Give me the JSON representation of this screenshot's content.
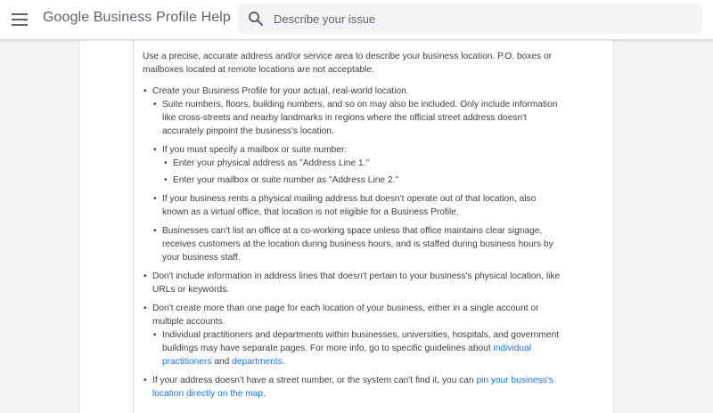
{
  "header": {
    "title": "Google Business Profile Help",
    "menu_icon": "hamburger-menu-icon",
    "search": {
      "placeholder": "Describe your issue",
      "value": "",
      "icon": "search-icon"
    }
  },
  "content": {
    "intro": "Use a precise, accurate address and/or service area to describe your business location. P.O. boxes or mailboxes located at remote locations are not acceptable.",
    "bullets": [
      {
        "text": "Create your Business Profile for your actual, real-world location.",
        "sub": [
          "Suite numbers, floors, building numbers, and so on may also be included. Only include information like cross-streets and nearby landmarks in regions where the official street address doesn't accurately pinpoint the business's location.",
          {
            "text": "If you must specify a mailbox or suite number:",
            "sub": [
              "Enter your physical address as \"Address Line 1.\"",
              "Enter your mailbox or suite number as \"Address Line 2.\""
            ]
          },
          "If your business rents a physical mailing address but doesn't operate out of that location, also known as a virtual office, that location is not eligible for a Business Profile.",
          "Businesses can't list an office at a co-working space unless that office maintains clear signage, receives customers at the location during business hours, and is staffed during business hours by your business staff."
        ]
      },
      {
        "text": "Don't include information in address lines that doesn't pertain to your business's physical location, like URLs or keywords."
      },
      {
        "text": "Don't create more than one page for each location of your business, either in a single account or multiple accounts.",
        "sub": [
          {
            "before": "Individual practitioners and departments within businesses, universities, hospitals, and government buildings may have separate pages. For more info, go to specific guidelines about ",
            "link1": "individual practitioners",
            "middle": " and ",
            "link2": "departments",
            "after": "."
          }
        ]
      },
      {
        "before": "If your address doesn't have a street number, or the system can't find it, you can ",
        "link": "pin your business's location directly on the map",
        "after": "."
      }
    ]
  },
  "colors": {
    "link": "#1a73e8",
    "text": "#3c4043",
    "background": "#f1f3f4"
  }
}
